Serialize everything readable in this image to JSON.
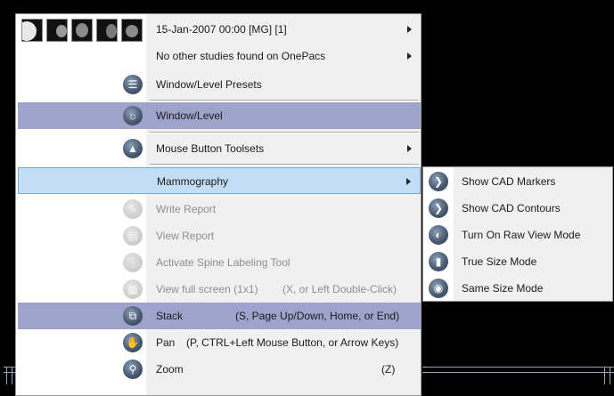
{
  "main_menu": {
    "items": [
      {
        "label": "15-Jan-2007 00:00 [MG] [1]"
      },
      {
        "label": "No other studies found on OnePacs"
      },
      {
        "label": "Window/Level Presets",
        "icon": "presets-icon"
      },
      {
        "label": "Window/Level",
        "icon": "window-level-icon"
      },
      {
        "label": "Mouse Button Toolsets",
        "icon": "toolsets-icon"
      },
      {
        "label": "Mammography"
      },
      {
        "label": "Write Report",
        "icon": "write-report-icon"
      },
      {
        "label": "View Report",
        "icon": "view-report-icon"
      },
      {
        "label": "Activate Spine Labeling Tool",
        "icon": "spine-icon"
      },
      {
        "label": "View full screen (1x1)",
        "shortcut": "(X, or Left Double-Click)",
        "icon": "fullscreen-icon"
      },
      {
        "label": "Stack",
        "shortcut": "(S, Page Up/Down, Home, or End)",
        "icon": "stack-icon"
      },
      {
        "label": "Pan",
        "shortcut": "(P, CTRL+Left Mouse Button, or Arrow Keys)",
        "icon": "pan-hand-icon"
      },
      {
        "label": "Zoom",
        "shortcut": "(Z)",
        "icon": "zoom-icon"
      }
    ]
  },
  "submenu": {
    "items": [
      {
        "label": "Show CAD Markers"
      },
      {
        "label": "Show CAD Contours"
      },
      {
        "label": "Turn On Raw View Mode"
      },
      {
        "label": "True Size Mode"
      },
      {
        "label": "Same Size Mode"
      }
    ]
  },
  "colors": {
    "highlight_gray": "#9fa3cc",
    "highlight_blue": "#c3ddf5",
    "disabled_text": "#8d8d8d",
    "menu_bg": "#f0f0f0"
  }
}
